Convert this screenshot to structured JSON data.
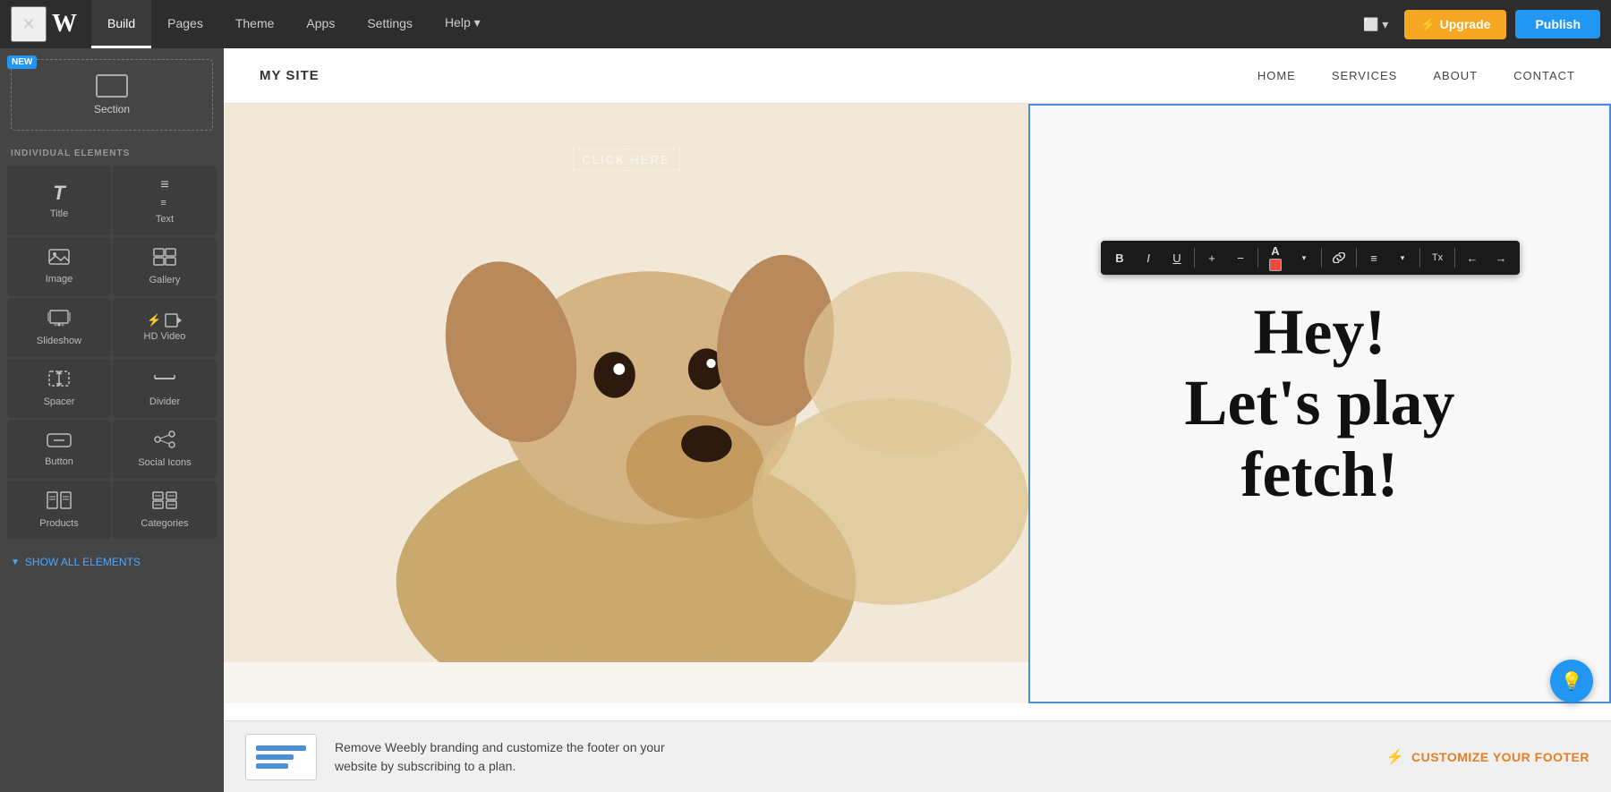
{
  "topbar": {
    "close_icon": "✕",
    "logo": "W",
    "tabs": [
      {
        "label": "Build",
        "active": true
      },
      {
        "label": "Pages",
        "active": false
      },
      {
        "label": "Theme",
        "active": false
      },
      {
        "label": "Apps",
        "active": false
      },
      {
        "label": "Settings",
        "active": false
      },
      {
        "label": "Help ▾",
        "active": false
      }
    ],
    "device_label": "⬜ ▾",
    "upgrade_label": "⚡ Upgrade",
    "publish_label": "Publish"
  },
  "sidebar": {
    "new_badge": "NEW",
    "section_label": "Section",
    "elements_heading": "INDIVIDUAL ELEMENTS",
    "elements": [
      {
        "icon": "T",
        "label": "Title"
      },
      {
        "icon": "≡",
        "label": "Text"
      },
      {
        "icon": "⬜",
        "label": "Image"
      },
      {
        "icon": "⊞",
        "label": "Gallery"
      },
      {
        "icon": "⬚⬚",
        "label": "Slideshow"
      },
      {
        "icon": "⚡▶",
        "label": "HD Video"
      },
      {
        "icon": "⊡",
        "label": "Spacer"
      },
      {
        "icon": "—",
        "label": "Divider"
      },
      {
        "icon": "▬",
        "label": "Button"
      },
      {
        "icon": "⋯",
        "label": "Social Icons"
      },
      {
        "icon": "⊞⊞",
        "label": "Products"
      },
      {
        "icon": "⊟⊟",
        "label": "Categories"
      }
    ],
    "show_all_label": "SHOW ALL ELEMENTS"
  },
  "site_header": {
    "logo": "MY SITE",
    "nav_items": [
      "HOME",
      "SERVICES",
      "ABOUT",
      "CONTACT"
    ]
  },
  "hero": {
    "click_here_text": "CLICK HERE",
    "headline_line1": "Hey!",
    "headline_line2": "Let's play",
    "headline_line3": "fetch!"
  },
  "toolbar": {
    "buttons": [
      "B",
      "I",
      "U",
      "+",
      "−",
      "A",
      "▾",
      "🔗",
      "≡",
      "▾",
      "Tx",
      "←",
      "→"
    ]
  },
  "footer_banner": {
    "text_line1": "Remove Weebly branding and customize the footer on your",
    "text_line2": "website by subscribing to a plan.",
    "customize_label": "CUSTOMIZE YOUR FOOTER"
  }
}
